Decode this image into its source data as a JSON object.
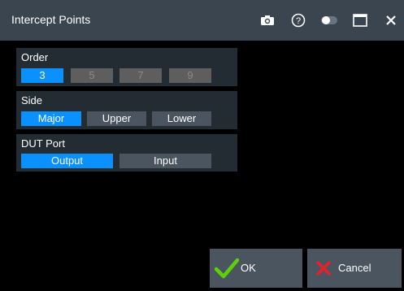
{
  "window": {
    "title": "Intercept Points"
  },
  "titlebar_icons": [
    "camera-icon",
    "help-icon",
    "toggle-icon",
    "maximize-icon",
    "close-icon"
  ],
  "order": {
    "label": "Order",
    "options": [
      "3",
      "5",
      "7",
      "9"
    ],
    "selected": "3",
    "disabled": [
      "5",
      "7",
      "9"
    ]
  },
  "side": {
    "label": "Side",
    "options": [
      "Major",
      "Upper",
      "Lower"
    ],
    "selected": "Major"
  },
  "dut_port": {
    "label": "DUT Port",
    "options": [
      "Output",
      "Input"
    ],
    "selected": "Output"
  },
  "buttons": {
    "ok_label": "OK",
    "cancel_label": "Cancel"
  },
  "colors": {
    "titlebar": "#3a4550",
    "section": "#232b33",
    "selected": "#0a90ff",
    "button": "#4a5560",
    "ok_check": "#5cd10a",
    "cancel_x": "#e8202a"
  }
}
